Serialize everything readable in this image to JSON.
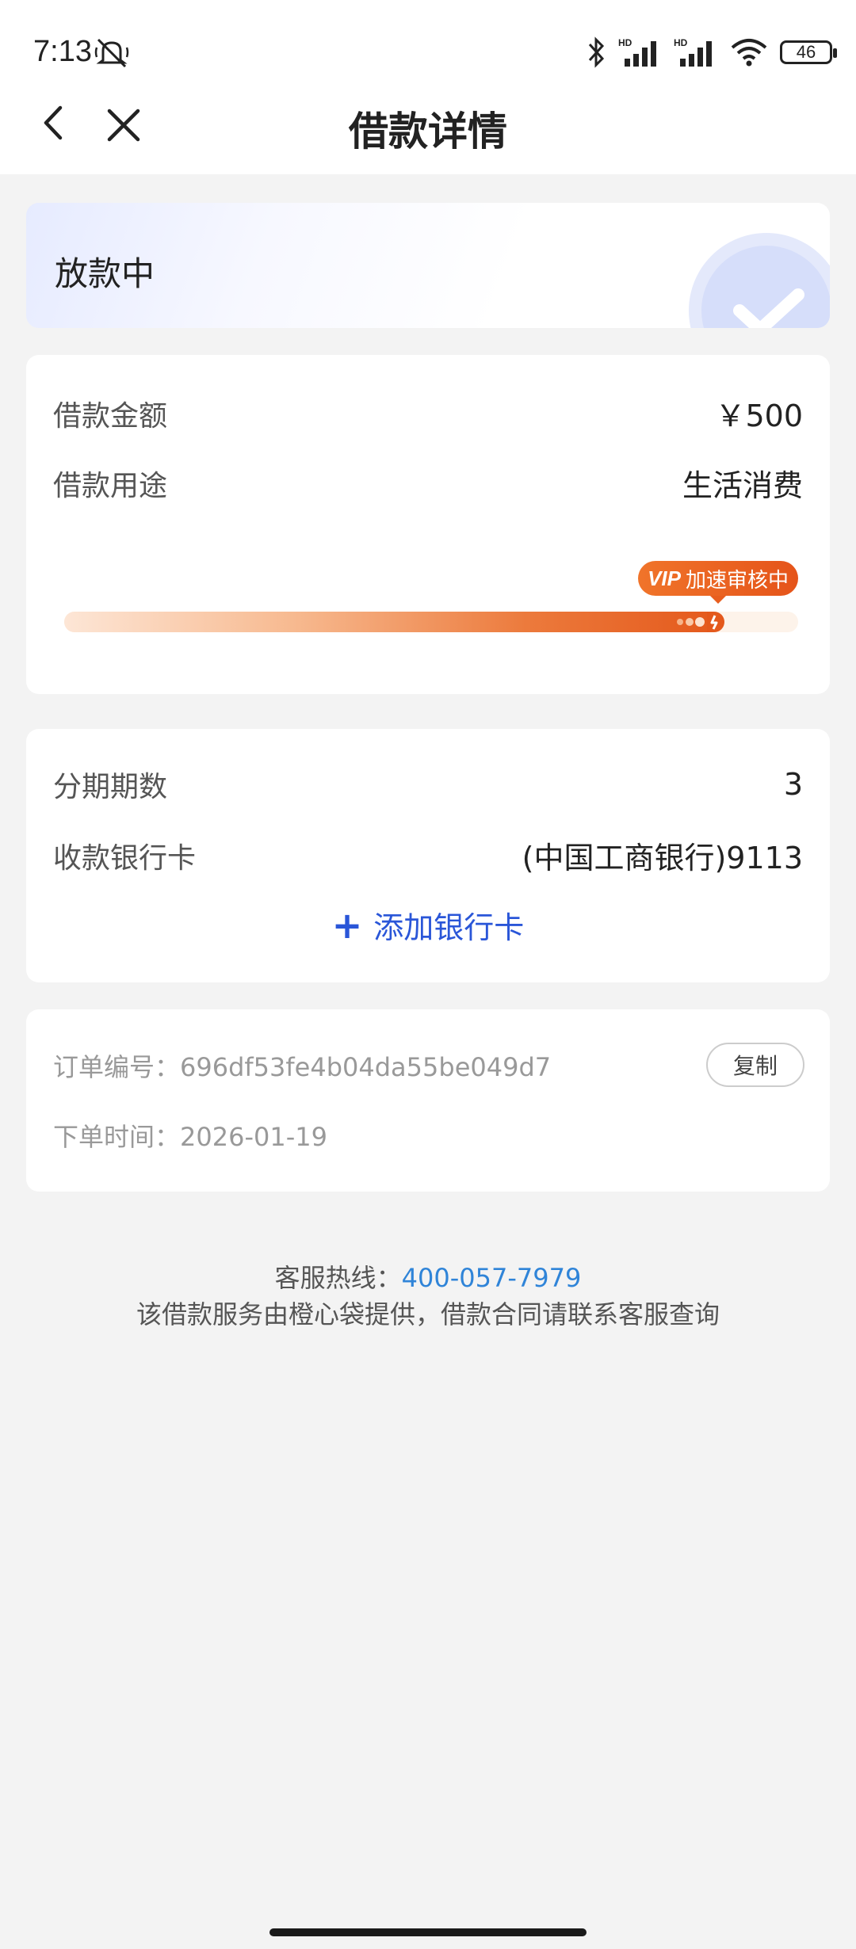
{
  "status_bar": {
    "time": "7:13",
    "battery": "46",
    "signal_label": "HD"
  },
  "nav": {
    "title": "借款详情"
  },
  "loan_status": {
    "text": "放款中"
  },
  "loan": {
    "amount_label": "借款金额",
    "amount_value": "￥500",
    "purpose_label": "借款用途",
    "purpose_value": "生活消费",
    "badge_vip": "VIP",
    "badge_text": "加速审核中",
    "progress_fraction": 0.9
  },
  "bank": {
    "periods_label": "分期期数",
    "periods_value": "3",
    "card_label": "收款银行卡",
    "card_value": "(中国工商银行)9113",
    "add_label": "添加银行卡"
  },
  "order": {
    "number_label": "订单编号：",
    "number_value": "696df53fe4b04da55be049d7",
    "copy_label": "复制",
    "time_label": "下单时间：",
    "time_value": "2026-01-19"
  },
  "footer": {
    "hotline_label": "客服热线：",
    "hotline_number": "400-057-7979",
    "note": "该借款服务由橙心袋提供，借款合同请联系客服查询"
  },
  "colors": {
    "accent_blue": "#2a56d8",
    "hotline_blue": "#2f84d8",
    "progress_orange": "#e4581b"
  }
}
